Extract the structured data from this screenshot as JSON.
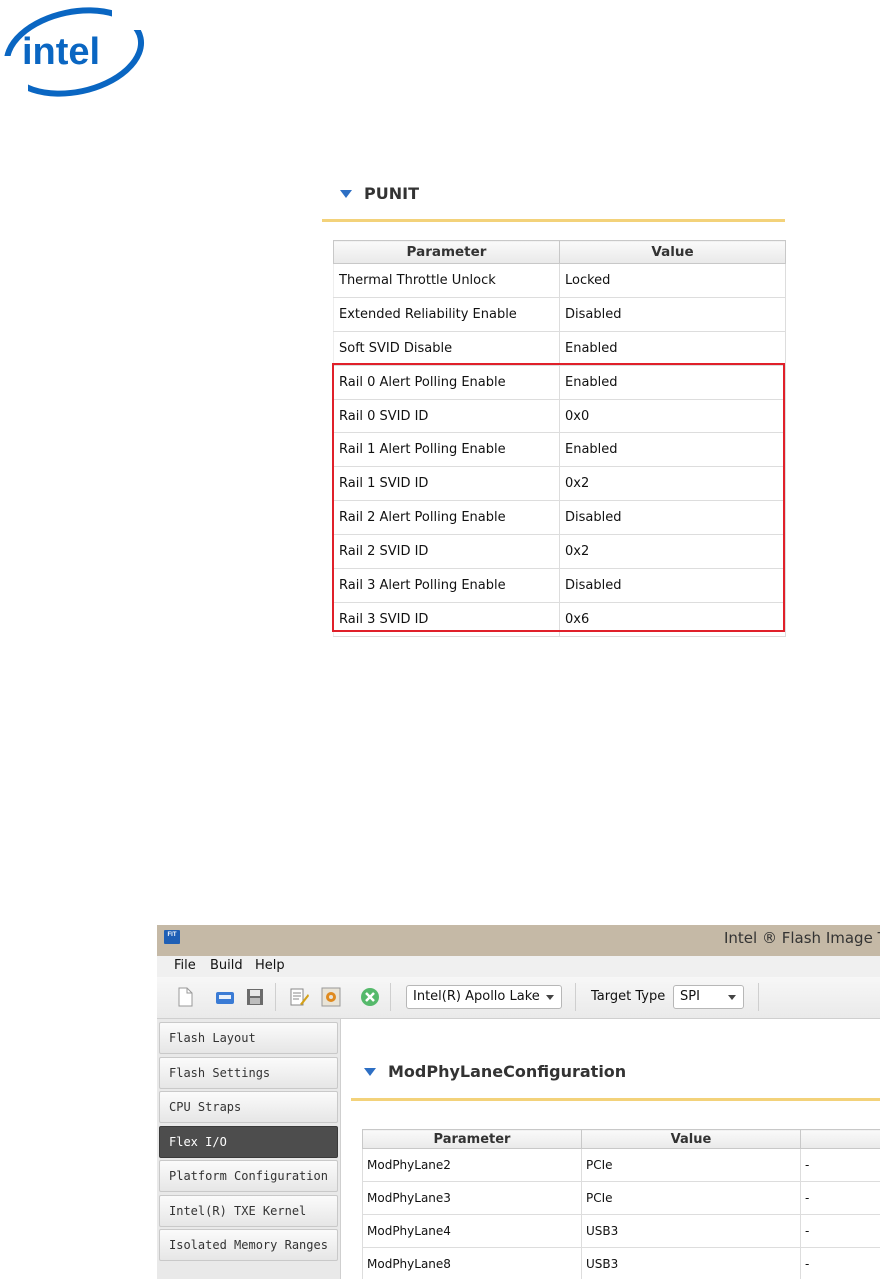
{
  "logo": {
    "text": "intel"
  },
  "punit": {
    "title": "PUNIT",
    "columns": [
      "Parameter",
      "Value"
    ],
    "rows": [
      [
        "Thermal Throttle Unlock",
        "Locked"
      ],
      [
        "Extended Reliability Enable",
        "Disabled"
      ],
      [
        "Soft SVID Disable",
        "Enabled"
      ],
      [
        "Rail 0 Alert Polling Enable",
        "Enabled"
      ],
      [
        "Rail 0 SVID ID",
        "0x0"
      ],
      [
        "Rail 1 Alert Polling Enable",
        "Enabled"
      ],
      [
        "Rail 1 SVID ID",
        "0x2"
      ],
      [
        "Rail 2 Alert Polling Enable",
        "Disabled"
      ],
      [
        "Rail 2 SVID ID",
        "0x2"
      ],
      [
        "Rail 3 Alert Polling Enable",
        "Disabled"
      ],
      [
        "Rail 3 SVID ID",
        "0x6"
      ]
    ],
    "highlight_color": "#e0202a"
  },
  "app": {
    "window_title": "Intel ® Flash Image T",
    "app_icon_text": "FIT",
    "menu": [
      "File",
      "Build",
      "Help"
    ],
    "toolbar": {
      "icons": [
        "new-file-icon",
        "open-icon",
        "save-icon",
        "edit-icon",
        "build-icon",
        "clean-icon"
      ],
      "platform_value": "Intel(R) Apollo Lake",
      "target_type_label": "Target Type",
      "target_type_value": "SPI"
    },
    "sidebar": [
      {
        "label": "Flash Layout",
        "active": false
      },
      {
        "label": "Flash Settings",
        "active": false
      },
      {
        "label": "CPU Straps",
        "active": false
      },
      {
        "label": "Flex I/O",
        "active": true
      },
      {
        "label": "Platform Configuration",
        "active": false
      },
      {
        "label": "Intel(R) TXE Kernel",
        "active": false
      },
      {
        "label": "Isolated Memory Ranges",
        "active": false
      }
    ],
    "section_title": "ModPhyLaneConfiguration",
    "columns": [
      "Parameter",
      "Value",
      ""
    ],
    "rows": [
      [
        "ModPhyLane2",
        "PCIe",
        "-"
      ],
      [
        "ModPhyLane3",
        "PCIe",
        "-"
      ],
      [
        "ModPhyLane4",
        "USB3",
        "-"
      ],
      [
        "ModPhyLane8",
        "USB3",
        "-"
      ]
    ],
    "accent_color": "#2d6fc4",
    "active_nav_color": "#4d4d4d"
  }
}
